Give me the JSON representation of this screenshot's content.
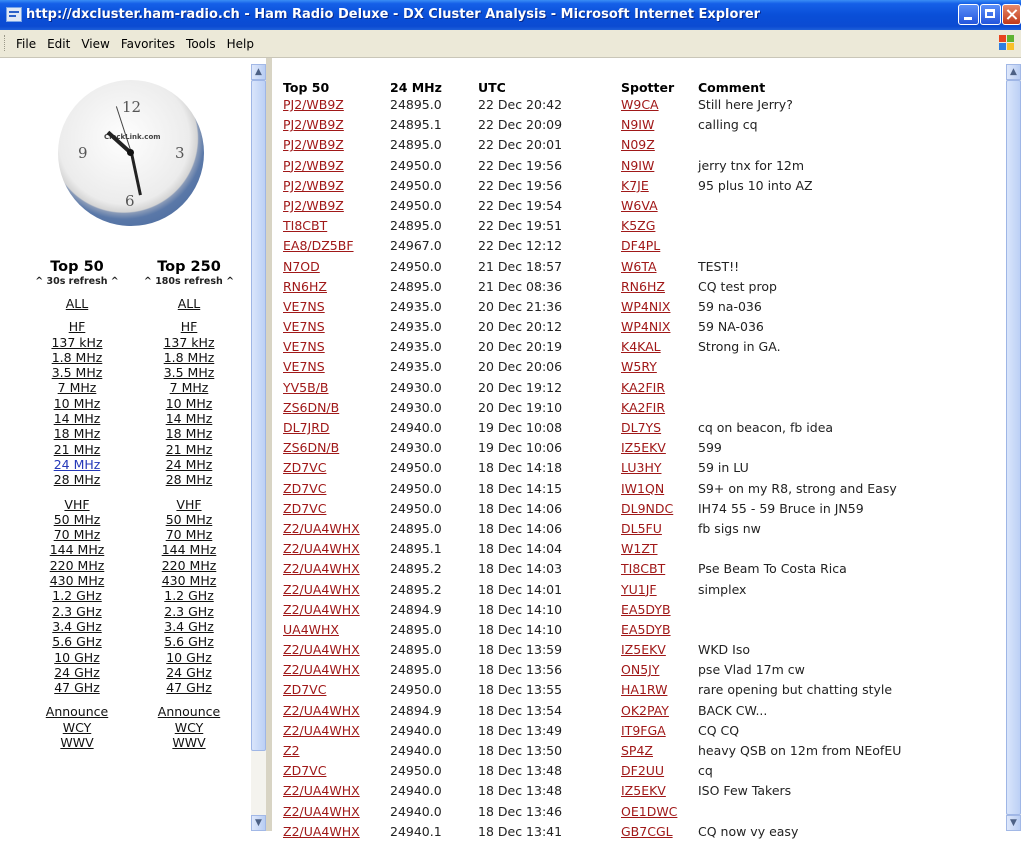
{
  "window": {
    "title": "http://dxcluster.ham-radio.ch - Ham Radio Deluxe - DX Cluster Analysis - Microsoft Internet Explorer"
  },
  "menu": [
    "File",
    "Edit",
    "View",
    "Favorites",
    "Tools",
    "Help"
  ],
  "clock": {
    "logo": "ClockLink.com",
    "numbers": {
      "n12": "12",
      "n3": "3",
      "n6": "6",
      "n9": "9"
    }
  },
  "nav": {
    "col1": {
      "title": "Top 50",
      "subtitle": "^ 30s refresh ^"
    },
    "col2": {
      "title": "Top 250",
      "subtitle": "^ 180s refresh ^"
    },
    "links": [
      "ALL",
      "HF",
      "137 kHz",
      "1.8 MHz",
      "3.5 MHz",
      "7 MHz",
      "10 MHz",
      "14 MHz",
      "18 MHz",
      "21 MHz",
      "24 MHz",
      "28 MHz",
      "VHF",
      "50 MHz",
      "70 MHz",
      "144 MHz",
      "220 MHz",
      "430 MHz",
      "1.2 GHz",
      "2.3 GHz",
      "3.4 GHz",
      "5.6 GHz",
      "10 GHz",
      "24 GHz",
      "47 GHz",
      "Announce",
      "WCY",
      "WWV"
    ],
    "col1_active": "24 MHz"
  },
  "table": {
    "headers": {
      "call": "Top 50",
      "freq": "24 MHz",
      "utc": "UTC",
      "spotter": "Spotter",
      "comment": "Comment"
    },
    "rows": [
      [
        "PJ2/WB9Z",
        "24895.0",
        "22 Dec 20:42",
        "W9CA",
        "Still here Jerry?"
      ],
      [
        "PJ2/WB9Z",
        "24895.1",
        "22 Dec 20:09",
        "N9IW",
        "calling cq"
      ],
      [
        "PJ2/WB9Z",
        "24895.0",
        "22 Dec 20:01",
        "N09Z",
        ""
      ],
      [
        "PJ2/WB9Z",
        "24950.0",
        "22 Dec 19:56",
        "N9IW",
        "jerry tnx for 12m"
      ],
      [
        "PJ2/WB9Z",
        "24950.0",
        "22 Dec 19:56",
        "K7JE",
        "95 plus 10 into AZ"
      ],
      [
        "PJ2/WB9Z",
        "24950.0",
        "22 Dec 19:54",
        "W6VA",
        ""
      ],
      [
        "TI8CBT",
        "24895.0",
        "22 Dec 19:51",
        "K5ZG",
        ""
      ],
      [
        "EA8/DZ5BF",
        "24967.0",
        "22 Dec 12:12",
        "DF4PL",
        ""
      ],
      [
        "N7OD",
        "24950.0",
        "21 Dec 18:57",
        "W6TA",
        "TEST!!"
      ],
      [
        "RN6HZ",
        "24895.0",
        "21 Dec 08:36",
        "RN6HZ",
        "CQ test prop"
      ],
      [
        "VE7NS",
        "24935.0",
        "20 Dec 21:36",
        "WP4NIX",
        "59 na-036"
      ],
      [
        "VE7NS",
        "24935.0",
        "20 Dec 20:12",
        "WP4NIX",
        "59 NA-036"
      ],
      [
        "VE7NS",
        "24935.0",
        "20 Dec 20:19",
        "K4KAL",
        "Strong in GA."
      ],
      [
        "VE7NS",
        "24935.0",
        "20 Dec 20:06",
        "W5RY",
        ""
      ],
      [
        "YV5B/B",
        "24930.0",
        "20 Dec 19:12",
        "KA2FIR",
        ""
      ],
      [
        "ZS6DN/B",
        "24930.0",
        "20 Dec 19:10",
        "KA2FIR",
        ""
      ],
      [
        "DL7JRD",
        "24940.0",
        "19 Dec 10:08",
        "DL7YS",
        "cq on beacon, fb idea"
      ],
      [
        "ZS6DN/B",
        "24930.0",
        "19 Dec 10:06",
        "IZ5EKV",
        "599"
      ],
      [
        "ZD7VC",
        "24950.0",
        "18 Dec 14:18",
        "LU3HY",
        "59 in LU"
      ],
      [
        "ZD7VC",
        "24950.0",
        "18 Dec 14:15",
        "IW1QN",
        "S9+ on my R8, strong and Easy"
      ],
      [
        "ZD7VC",
        "24950.0",
        "18 Dec 14:06",
        "DL9NDC",
        "IH74 55 - 59 Bruce in JN59"
      ],
      [
        "Z2/UA4WHX",
        "24895.0",
        "18 Dec 14:06",
        "DL5FU",
        "fb sigs nw"
      ],
      [
        "Z2/UA4WHX",
        "24895.1",
        "18 Dec 14:04",
        "W1ZT",
        ""
      ],
      [
        "Z2/UA4WHX",
        "24895.2",
        "18 Dec 14:03",
        "TI8CBT",
        "Pse Beam To Costa Rica"
      ],
      [
        "Z2/UA4WHX",
        "24895.2",
        "18 Dec 14:01",
        "YU1JF",
        "simplex"
      ],
      [
        "Z2/UA4WHX",
        "24894.9",
        "18 Dec 14:10",
        "EA5DYB",
        ""
      ],
      [
        "UA4WHX",
        "24895.0",
        "18 Dec 14:10",
        "EA5DYB",
        ""
      ],
      [
        "Z2/UA4WHX",
        "24895.0",
        "18 Dec 13:59",
        "IZ5EKV",
        "WKD Iso"
      ],
      [
        "Z2/UA4WHX",
        "24895.0",
        "18 Dec 13:56",
        "ON5JY",
        "pse Vlad 17m cw"
      ],
      [
        "ZD7VC",
        "24950.0",
        "18 Dec 13:55",
        "HA1RW",
        "rare opening but chatting style"
      ],
      [
        "Z2/UA4WHX",
        "24894.9",
        "18 Dec 13:54",
        "OK2PAY",
        "BACK CW..."
      ],
      [
        "Z2/UA4WHX",
        "24940.0",
        "18 Dec 13:49",
        "IT9FGA",
        "CQ CQ"
      ],
      [
        "Z2",
        "24940.0",
        "18 Dec 13:50",
        "SP4Z",
        "heavy QSB on 12m from NEofEU"
      ],
      [
        "ZD7VC",
        "24950.0",
        "18 Dec 13:48",
        "DF2UU",
        "cq"
      ],
      [
        "Z2/UA4WHX",
        "24940.0",
        "18 Dec 13:48",
        "IZ5EKV",
        "ISO Few Takers"
      ],
      [
        "Z2/UA4WHX",
        "24940.0",
        "18 Dec 13:46",
        "OE1DWC",
        ""
      ],
      [
        "Z2/UA4WHX",
        "24940.1",
        "18 Dec 13:41",
        "GB7CGL",
        "CQ now vy easy"
      ]
    ]
  }
}
